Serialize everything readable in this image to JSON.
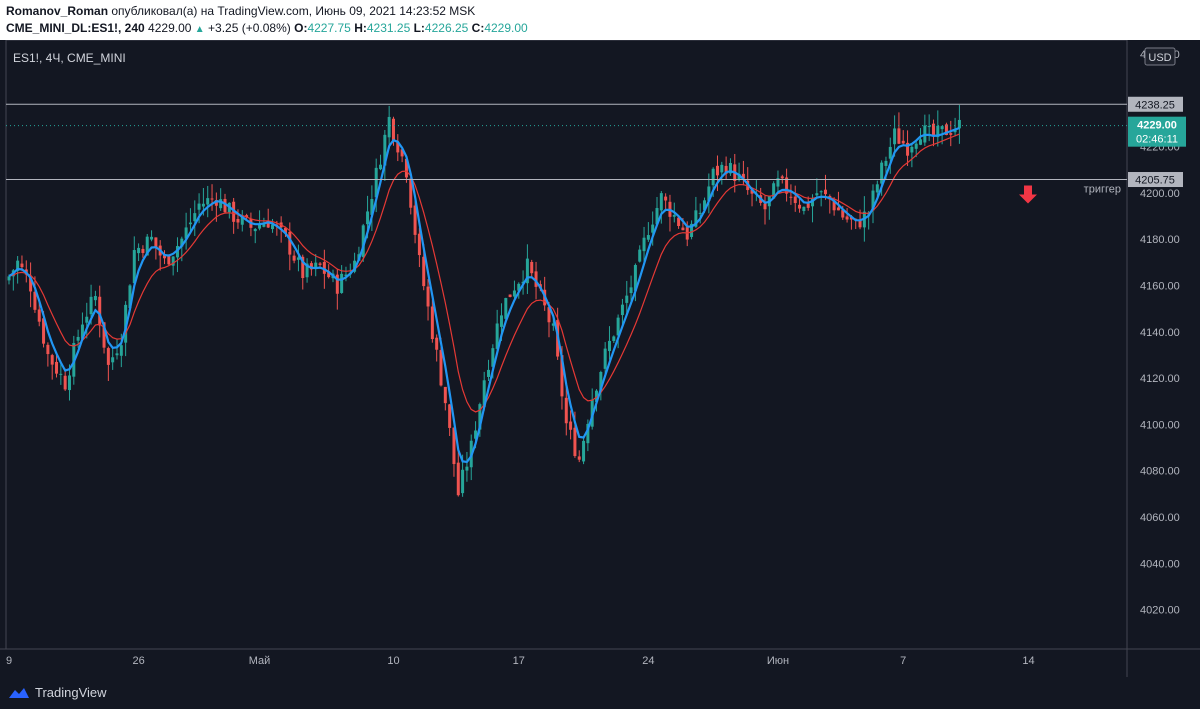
{
  "header": {
    "author": "Romanov_Roman",
    "published": "опубликовал(а) на TradingView.com, Июнь 09, 2021 14:23:52 MSK",
    "symbol_line": "CME_MINI_DL:ES1!, 240",
    "last_price": "4229.00",
    "change": "+3.25 (+0.08%)",
    "o_label": "O:",
    "o_value": "4227.75",
    "h_label": "H:",
    "h_value": "4231.25",
    "l_label": "L:",
    "l_value": "4226.25",
    "c_label": "C:",
    "c_value": "4229.00"
  },
  "chart": {
    "legend": "ES1!, 4Ч, CME_MINI",
    "currency": "USD",
    "price_tag": "4229.00",
    "countdown": "02:46:11",
    "level_high_tag": "4238.25",
    "level_low_tag": "4205.75",
    "trigger_label": "триггер"
  },
  "footer": {
    "brand": "TradingView"
  },
  "colors": {
    "background": "#131722",
    "up": "#26a69a",
    "down": "#ef5350",
    "fast_ma": "#2196f3",
    "slow_ma": "#e53935",
    "arrow": "#f23645"
  },
  "chart_data": {
    "type": "candlestick",
    "y_ticks": [
      4020,
      4040,
      4060,
      4080,
      4100,
      4120,
      4140,
      4160,
      4180,
      4200,
      4220,
      4260
    ],
    "ylim": [
      4003,
      4266
    ],
    "x_ticks": [
      "9",
      "26",
      "Май",
      "10",
      "17",
      "24",
      "Июн",
      "7",
      "14"
    ],
    "x_tick_index": [
      0,
      30,
      58,
      89,
      118,
      148,
      178,
      207,
      236
    ],
    "horizontal_levels": [
      4238.25,
      4205.75
    ],
    "last_close": 4229.0,
    "series": [
      {
        "name": "price",
        "anchors": [
          [
            0,
            4164
          ],
          [
            2,
            4170
          ],
          [
            5,
            4160
          ],
          [
            9,
            4130
          ],
          [
            13,
            4118
          ],
          [
            17,
            4145
          ],
          [
            20,
            4155
          ],
          [
            23,
            4125
          ],
          [
            26,
            4138
          ],
          [
            29,
            4175
          ],
          [
            33,
            4180
          ],
          [
            36,
            4170
          ],
          [
            40,
            4180
          ],
          [
            44,
            4195
          ],
          [
            48,
            4198
          ],
          [
            52,
            4190
          ],
          [
            56,
            4185
          ],
          [
            60,
            4188
          ],
          [
            64,
            4180
          ],
          [
            68,
            4165
          ],
          [
            72,
            4168
          ],
          [
            76,
            4160
          ],
          [
            80,
            4170
          ],
          [
            84,
            4200
          ],
          [
            88,
            4232
          ],
          [
            92,
            4210
          ],
          [
            95,
            4170
          ],
          [
            98,
            4140
          ],
          [
            101,
            4110
          ],
          [
            104,
            4070
          ],
          [
            107,
            4090
          ],
          [
            110,
            4120
          ],
          [
            114,
            4150
          ],
          [
            117,
            4160
          ],
          [
            120,
            4168
          ],
          [
            123,
            4155
          ],
          [
            126,
            4140
          ],
          [
            129,
            4100
          ],
          [
            132,
            4085
          ],
          [
            135,
            4112
          ],
          [
            138,
            4130
          ],
          [
            142,
            4150
          ],
          [
            145,
            4165
          ],
          [
            148,
            4185
          ],
          [
            151,
            4198
          ],
          [
            154,
            4190
          ],
          [
            157,
            4182
          ],
          [
            160,
            4192
          ],
          [
            163,
            4208
          ],
          [
            166,
            4212
          ],
          [
            169,
            4206
          ],
          [
            172,
            4198
          ],
          [
            175,
            4193
          ],
          [
            178,
            4204
          ],
          [
            181,
            4200
          ],
          [
            184,
            4193
          ],
          [
            187,
            4200
          ],
          [
            190,
            4197
          ],
          [
            193,
            4190
          ],
          [
            196,
            4186
          ],
          [
            199,
            4192
          ],
          [
            202,
            4210
          ],
          [
            205,
            4225
          ],
          [
            208,
            4220
          ],
          [
            211,
            4227
          ],
          [
            214,
            4224
          ],
          [
            217,
            4227
          ],
          [
            220,
            4229
          ]
        ]
      }
    ]
  }
}
